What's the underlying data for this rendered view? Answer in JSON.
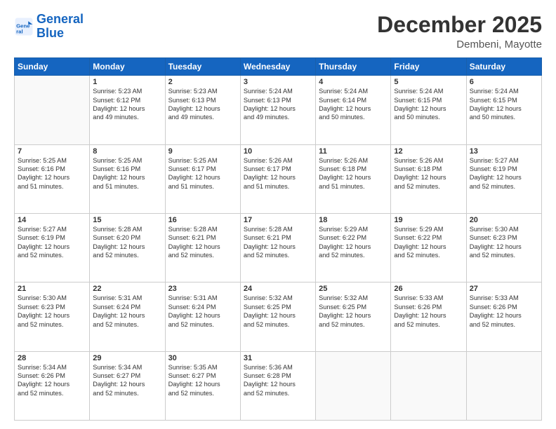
{
  "logo": {
    "line1": "General",
    "line2": "Blue"
  },
  "header": {
    "month_year": "December 2025",
    "location": "Dembeni, Mayotte"
  },
  "days_of_week": [
    "Sunday",
    "Monday",
    "Tuesday",
    "Wednesday",
    "Thursday",
    "Friday",
    "Saturday"
  ],
  "weeks": [
    [
      {
        "day": "",
        "info": ""
      },
      {
        "day": "1",
        "info": "Sunrise: 5:23 AM\nSunset: 6:12 PM\nDaylight: 12 hours\nand 49 minutes."
      },
      {
        "day": "2",
        "info": "Sunrise: 5:23 AM\nSunset: 6:13 PM\nDaylight: 12 hours\nand 49 minutes."
      },
      {
        "day": "3",
        "info": "Sunrise: 5:24 AM\nSunset: 6:13 PM\nDaylight: 12 hours\nand 49 minutes."
      },
      {
        "day": "4",
        "info": "Sunrise: 5:24 AM\nSunset: 6:14 PM\nDaylight: 12 hours\nand 50 minutes."
      },
      {
        "day": "5",
        "info": "Sunrise: 5:24 AM\nSunset: 6:15 PM\nDaylight: 12 hours\nand 50 minutes."
      },
      {
        "day": "6",
        "info": "Sunrise: 5:24 AM\nSunset: 6:15 PM\nDaylight: 12 hours\nand 50 minutes."
      }
    ],
    [
      {
        "day": "7",
        "info": "Sunrise: 5:25 AM\nSunset: 6:16 PM\nDaylight: 12 hours\nand 51 minutes."
      },
      {
        "day": "8",
        "info": "Sunrise: 5:25 AM\nSunset: 6:16 PM\nDaylight: 12 hours\nand 51 minutes."
      },
      {
        "day": "9",
        "info": "Sunrise: 5:25 AM\nSunset: 6:17 PM\nDaylight: 12 hours\nand 51 minutes."
      },
      {
        "day": "10",
        "info": "Sunrise: 5:26 AM\nSunset: 6:17 PM\nDaylight: 12 hours\nand 51 minutes."
      },
      {
        "day": "11",
        "info": "Sunrise: 5:26 AM\nSunset: 6:18 PM\nDaylight: 12 hours\nand 51 minutes."
      },
      {
        "day": "12",
        "info": "Sunrise: 5:26 AM\nSunset: 6:18 PM\nDaylight: 12 hours\nand 52 minutes."
      },
      {
        "day": "13",
        "info": "Sunrise: 5:27 AM\nSunset: 6:19 PM\nDaylight: 12 hours\nand 52 minutes."
      }
    ],
    [
      {
        "day": "14",
        "info": "Sunrise: 5:27 AM\nSunset: 6:19 PM\nDaylight: 12 hours\nand 52 minutes."
      },
      {
        "day": "15",
        "info": "Sunrise: 5:28 AM\nSunset: 6:20 PM\nDaylight: 12 hours\nand 52 minutes."
      },
      {
        "day": "16",
        "info": "Sunrise: 5:28 AM\nSunset: 6:21 PM\nDaylight: 12 hours\nand 52 minutes."
      },
      {
        "day": "17",
        "info": "Sunrise: 5:28 AM\nSunset: 6:21 PM\nDaylight: 12 hours\nand 52 minutes."
      },
      {
        "day": "18",
        "info": "Sunrise: 5:29 AM\nSunset: 6:22 PM\nDaylight: 12 hours\nand 52 minutes."
      },
      {
        "day": "19",
        "info": "Sunrise: 5:29 AM\nSunset: 6:22 PM\nDaylight: 12 hours\nand 52 minutes."
      },
      {
        "day": "20",
        "info": "Sunrise: 5:30 AM\nSunset: 6:23 PM\nDaylight: 12 hours\nand 52 minutes."
      }
    ],
    [
      {
        "day": "21",
        "info": "Sunrise: 5:30 AM\nSunset: 6:23 PM\nDaylight: 12 hours\nand 52 minutes."
      },
      {
        "day": "22",
        "info": "Sunrise: 5:31 AM\nSunset: 6:24 PM\nDaylight: 12 hours\nand 52 minutes."
      },
      {
        "day": "23",
        "info": "Sunrise: 5:31 AM\nSunset: 6:24 PM\nDaylight: 12 hours\nand 52 minutes."
      },
      {
        "day": "24",
        "info": "Sunrise: 5:32 AM\nSunset: 6:25 PM\nDaylight: 12 hours\nand 52 minutes."
      },
      {
        "day": "25",
        "info": "Sunrise: 5:32 AM\nSunset: 6:25 PM\nDaylight: 12 hours\nand 52 minutes."
      },
      {
        "day": "26",
        "info": "Sunrise: 5:33 AM\nSunset: 6:26 PM\nDaylight: 12 hours\nand 52 minutes."
      },
      {
        "day": "27",
        "info": "Sunrise: 5:33 AM\nSunset: 6:26 PM\nDaylight: 12 hours\nand 52 minutes."
      }
    ],
    [
      {
        "day": "28",
        "info": "Sunrise: 5:34 AM\nSunset: 6:26 PM\nDaylight: 12 hours\nand 52 minutes."
      },
      {
        "day": "29",
        "info": "Sunrise: 5:34 AM\nSunset: 6:27 PM\nDaylight: 12 hours\nand 52 minutes."
      },
      {
        "day": "30",
        "info": "Sunrise: 5:35 AM\nSunset: 6:27 PM\nDaylight: 12 hours\nand 52 minutes."
      },
      {
        "day": "31",
        "info": "Sunrise: 5:36 AM\nSunset: 6:28 PM\nDaylight: 12 hours\nand 52 minutes."
      },
      {
        "day": "",
        "info": ""
      },
      {
        "day": "",
        "info": ""
      },
      {
        "day": "",
        "info": ""
      }
    ]
  ]
}
